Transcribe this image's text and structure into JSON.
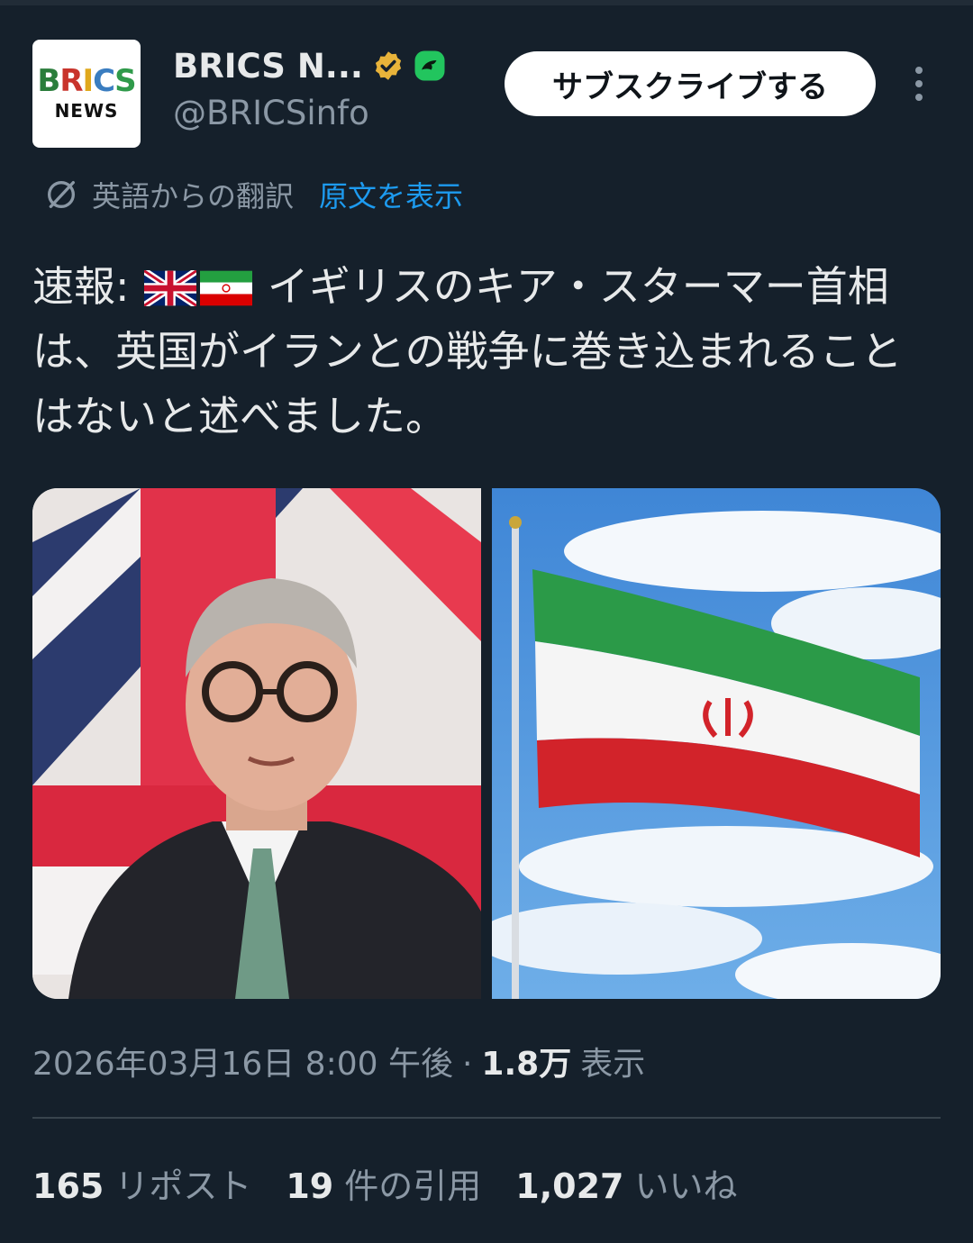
{
  "account": {
    "display_name": "BRICS N...",
    "handle": "@BRICSinfo",
    "avatar_text_top": "BRICS",
    "avatar_text_bottom": "NEWS",
    "verified_badge": "gold-check-badge",
    "affiliate_badge": "green-affiliate-badge"
  },
  "actions": {
    "subscribe_label": "サブスクライブする",
    "more_icon": "more-vertical-icon"
  },
  "translation": {
    "label": "英語からの翻訳",
    "show_original": "原文を表示",
    "icon": "translate-icon"
  },
  "tweet": {
    "prefix": "速報:",
    "flags": [
      "uk-flag",
      "iran-flag"
    ],
    "text": "イギリスのキア・スターマー首相は、英国がイランとの戦争に巻き込まれることはないと述べました。"
  },
  "media": [
    {
      "name": "starmer-photo"
    },
    {
      "name": "iran-flag-photo"
    }
  ],
  "meta": {
    "timestamp": "2026年03月16日 8:00 午後",
    "separator": "·",
    "views_count": "1.8万",
    "views_label": "表示"
  },
  "stats": [
    {
      "count": "165",
      "label": "リポスト"
    },
    {
      "count": "19",
      "label": "件の引用"
    },
    {
      "count": "1,027",
      "label": "いいね"
    }
  ],
  "colors": {
    "background": "#15202b",
    "text_primary": "#e7e9ea",
    "text_secondary": "#8b98a5",
    "link": "#1d9bf0",
    "divider": "#38444d",
    "button_bg": "#ffffff"
  }
}
